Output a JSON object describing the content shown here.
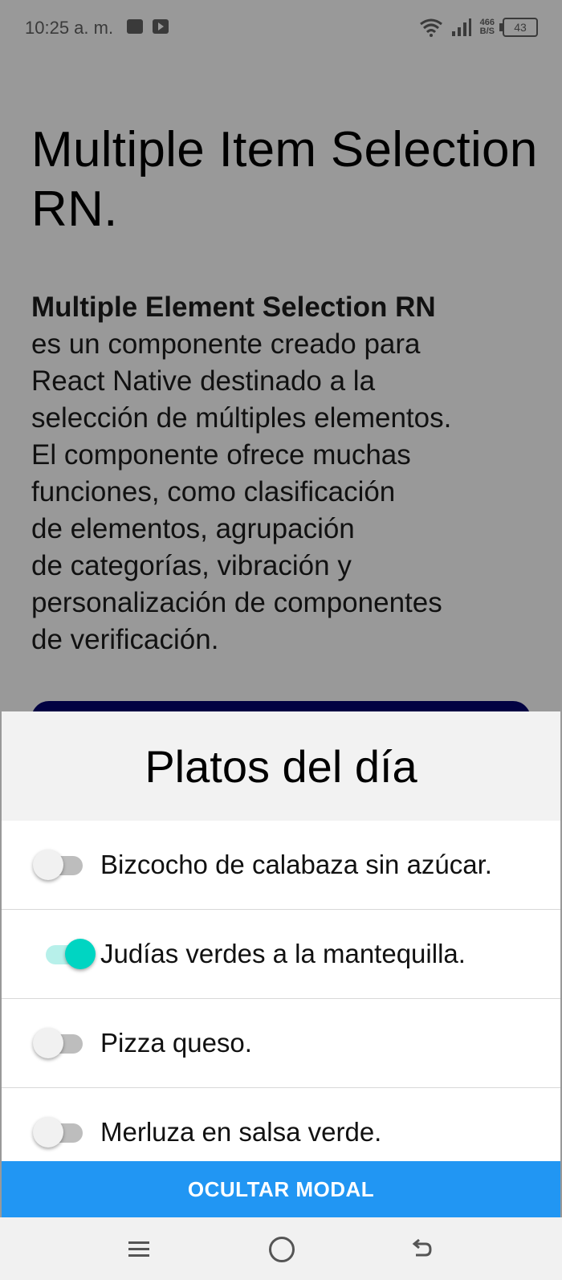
{
  "status_bar": {
    "time": "10:25 a. m.",
    "net_speed_value": "466",
    "net_speed_unit": "B/S",
    "battery": "43"
  },
  "main": {
    "title": "Multiple Item Selection RN.",
    "description_strong": "Multiple Element Selection RN",
    "description_body": "es un componente creado para\nReact Native destinado a la\nselección de múltiples elementos.\nEl componente ofrece muchas\nfunciones, como clasificación\nde elementos, agrupación\nde categorías, vibración y\npersonalización de componentes\nde verificación."
  },
  "modal": {
    "title": "Platos del día",
    "items": [
      {
        "label": "Bizcocho de calabaza sin azúcar.",
        "selected": false
      },
      {
        "label": "Judías verdes a la mantequilla.",
        "selected": true
      },
      {
        "label": "Pizza queso.",
        "selected": false
      },
      {
        "label": "Merluza en salsa verde.",
        "selected": false
      }
    ],
    "hide_button_label": "OCULTAR MODAL"
  },
  "colors": {
    "accent_switch": "#00d5c2",
    "button": "#2196f3",
    "underlay_button": "#020242",
    "overlay": "#999999"
  },
  "icons": {
    "status_app_icons": [
      "document-icon",
      "youtube-icon"
    ],
    "status_right": [
      "wifi-icon",
      "signal-icon",
      "battery-icon"
    ],
    "nav": [
      "menu-icon",
      "home-icon",
      "back-icon"
    ]
  }
}
